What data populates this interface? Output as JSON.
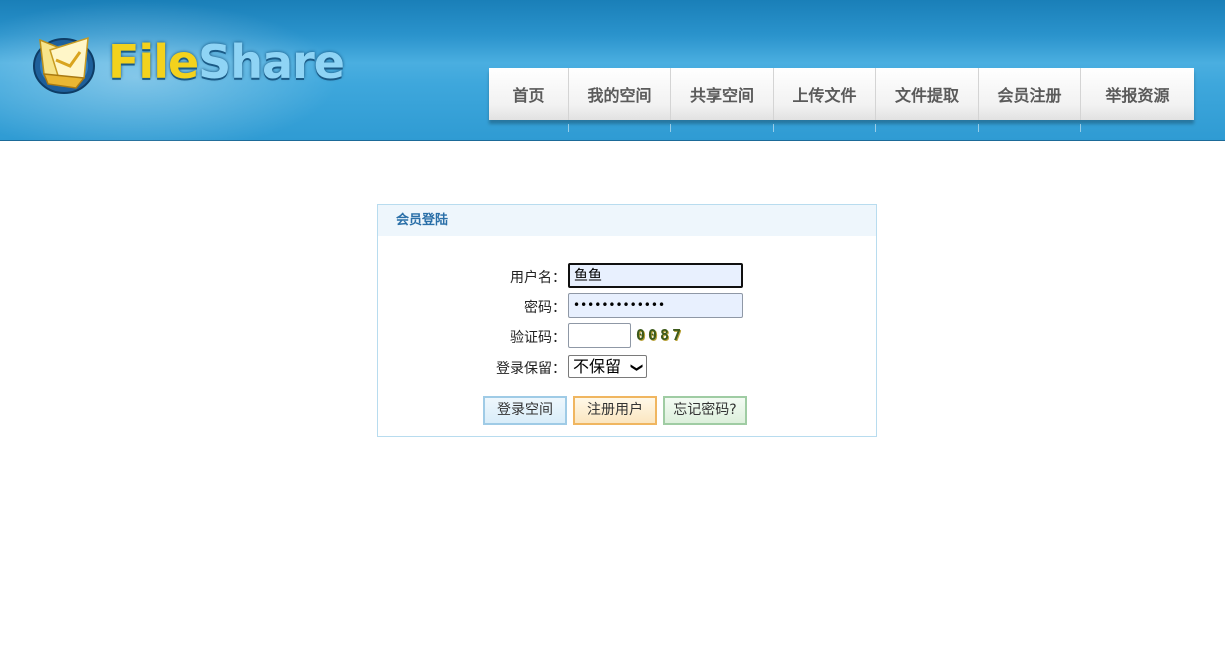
{
  "brand": {
    "name_part1": "File",
    "name_part2": "Share"
  },
  "nav": {
    "items": [
      {
        "label": "首页"
      },
      {
        "label": "我的空间"
      },
      {
        "label": "共享空间"
      },
      {
        "label": "上传文件"
      },
      {
        "label": "文件提取"
      },
      {
        "label": "会员注册"
      },
      {
        "label": "举报资源"
      }
    ]
  },
  "login": {
    "title": "会员登陆",
    "username_label": "用户名：",
    "username_value": "鱼鱼",
    "password_label": "密码：",
    "password_value": "•••••••••••••",
    "captcha_label": "验证码：",
    "captcha_value": "",
    "captcha_image_text": "0087",
    "remember_label": "登录保留：",
    "remember_selected": "不保留",
    "login_button": "登录空间",
    "register_button": "注册用户",
    "forgot_button": "忘记密码?"
  },
  "colors": {
    "header_blue": "#2f9bd3",
    "panel_border": "#b8dcef",
    "panel_title": "#2a6fa8"
  }
}
